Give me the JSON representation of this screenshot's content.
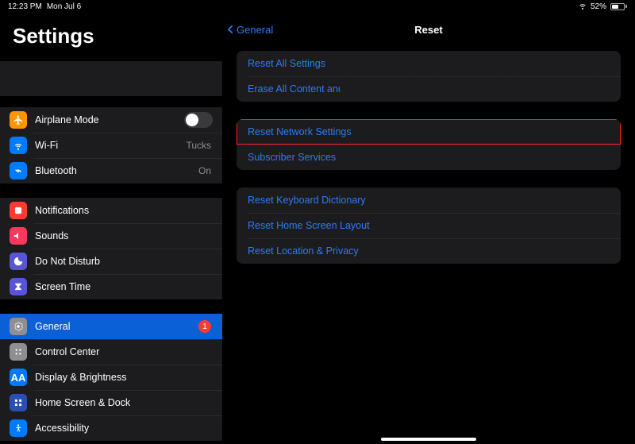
{
  "status": {
    "time": "12:23 PM",
    "date": "Mon Jul 6",
    "battery_percent": "52%"
  },
  "sidebar": {
    "title": "Settings",
    "airplane": {
      "label": "Airplane Mode"
    },
    "wifi": {
      "label": "Wi-Fi",
      "value": "Tucks"
    },
    "bluetooth": {
      "label": "Bluetooth",
      "value": "On"
    },
    "notifications": {
      "label": "Notifications"
    },
    "sounds": {
      "label": "Sounds"
    },
    "dnd": {
      "label": "Do Not Disturb"
    },
    "screentime": {
      "label": "Screen Time"
    },
    "general": {
      "label": "General",
      "badge": "1"
    },
    "control_center": {
      "label": "Control Center"
    },
    "display": {
      "label": "Display & Brightness"
    },
    "home_screen": {
      "label": "Home Screen & Dock"
    },
    "accessibility": {
      "label": "Accessibility"
    }
  },
  "main": {
    "back_label": "General",
    "title": "Reset",
    "group1": {
      "reset_all": "Reset All Settings",
      "erase_all": "Erase All Content and Settings"
    },
    "group2": {
      "reset_network": "Reset Network Settings",
      "subscriber": "Subscriber Services"
    },
    "group3": {
      "keyboard": "Reset Keyboard Dictionary",
      "home_layout": "Reset Home Screen Layout",
      "location": "Reset Location & Privacy"
    }
  }
}
